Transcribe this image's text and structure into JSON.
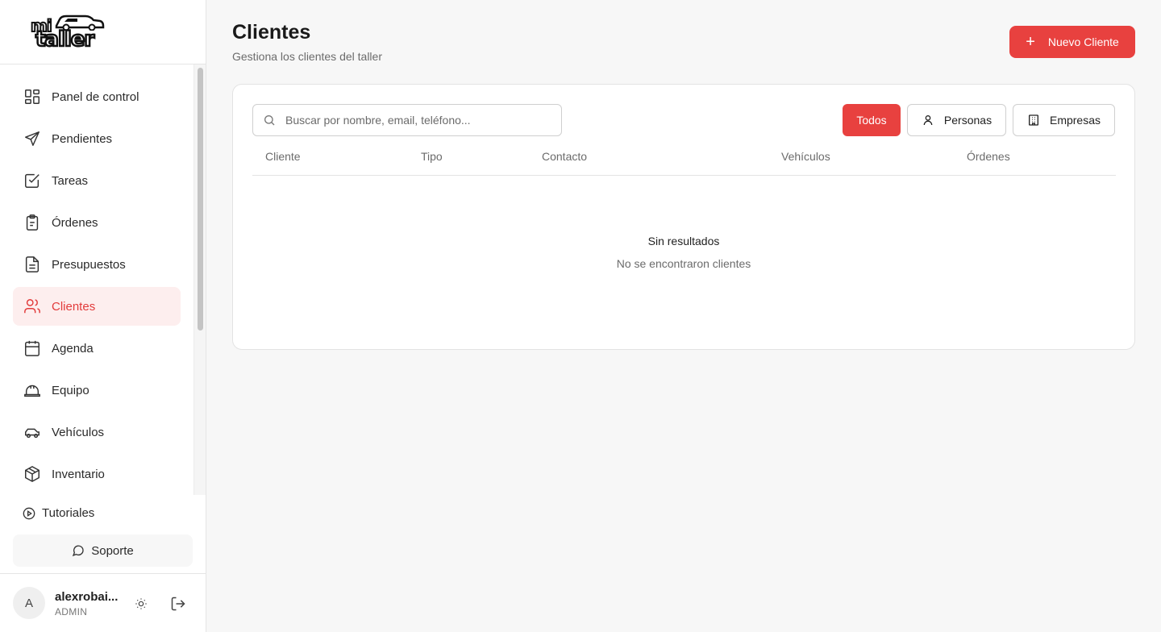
{
  "brand": {
    "logo_line1": "mi",
    "logo_line2": "taller"
  },
  "sidebar": {
    "items": [
      {
        "label": "Panel de control",
        "icon": "dashboard-icon"
      },
      {
        "label": "Pendientes",
        "icon": "send-icon"
      },
      {
        "label": "Tareas",
        "icon": "checkbox-icon"
      },
      {
        "label": "Órdenes",
        "icon": "clipboard-icon"
      },
      {
        "label": "Presupuestos",
        "icon": "document-icon"
      },
      {
        "label": "Clientes",
        "icon": "users-icon",
        "active": true
      },
      {
        "label": "Agenda",
        "icon": "calendar-icon"
      },
      {
        "label": "Equipo",
        "icon": "hard-hat-icon"
      },
      {
        "label": "Vehículos",
        "icon": "car-icon"
      },
      {
        "label": "Inventario",
        "icon": "box-icon"
      }
    ],
    "tutorials_label": "Tutoriales",
    "support_label": "Soporte",
    "user": {
      "initial": "A",
      "name": "alexrobai...",
      "role": "ADMIN"
    }
  },
  "header": {
    "title": "Clientes",
    "subtitle": "Gestiona los clientes del taller",
    "new_button_label": "Nuevo Cliente"
  },
  "search": {
    "placeholder": "Buscar por nombre, email, teléfono...",
    "value": ""
  },
  "filters": {
    "all": "Todos",
    "persons": "Personas",
    "companies": "Empresas",
    "selected": "Todos"
  },
  "table": {
    "columns": [
      "Cliente",
      "Tipo",
      "Contacto",
      "Vehículos",
      "Órdenes"
    ],
    "empty_title": "Sin resultados",
    "empty_subtitle": "No se encontraron clientes"
  },
  "colors": {
    "accent": "#e8413f",
    "active_bg": "#fdeeee"
  }
}
